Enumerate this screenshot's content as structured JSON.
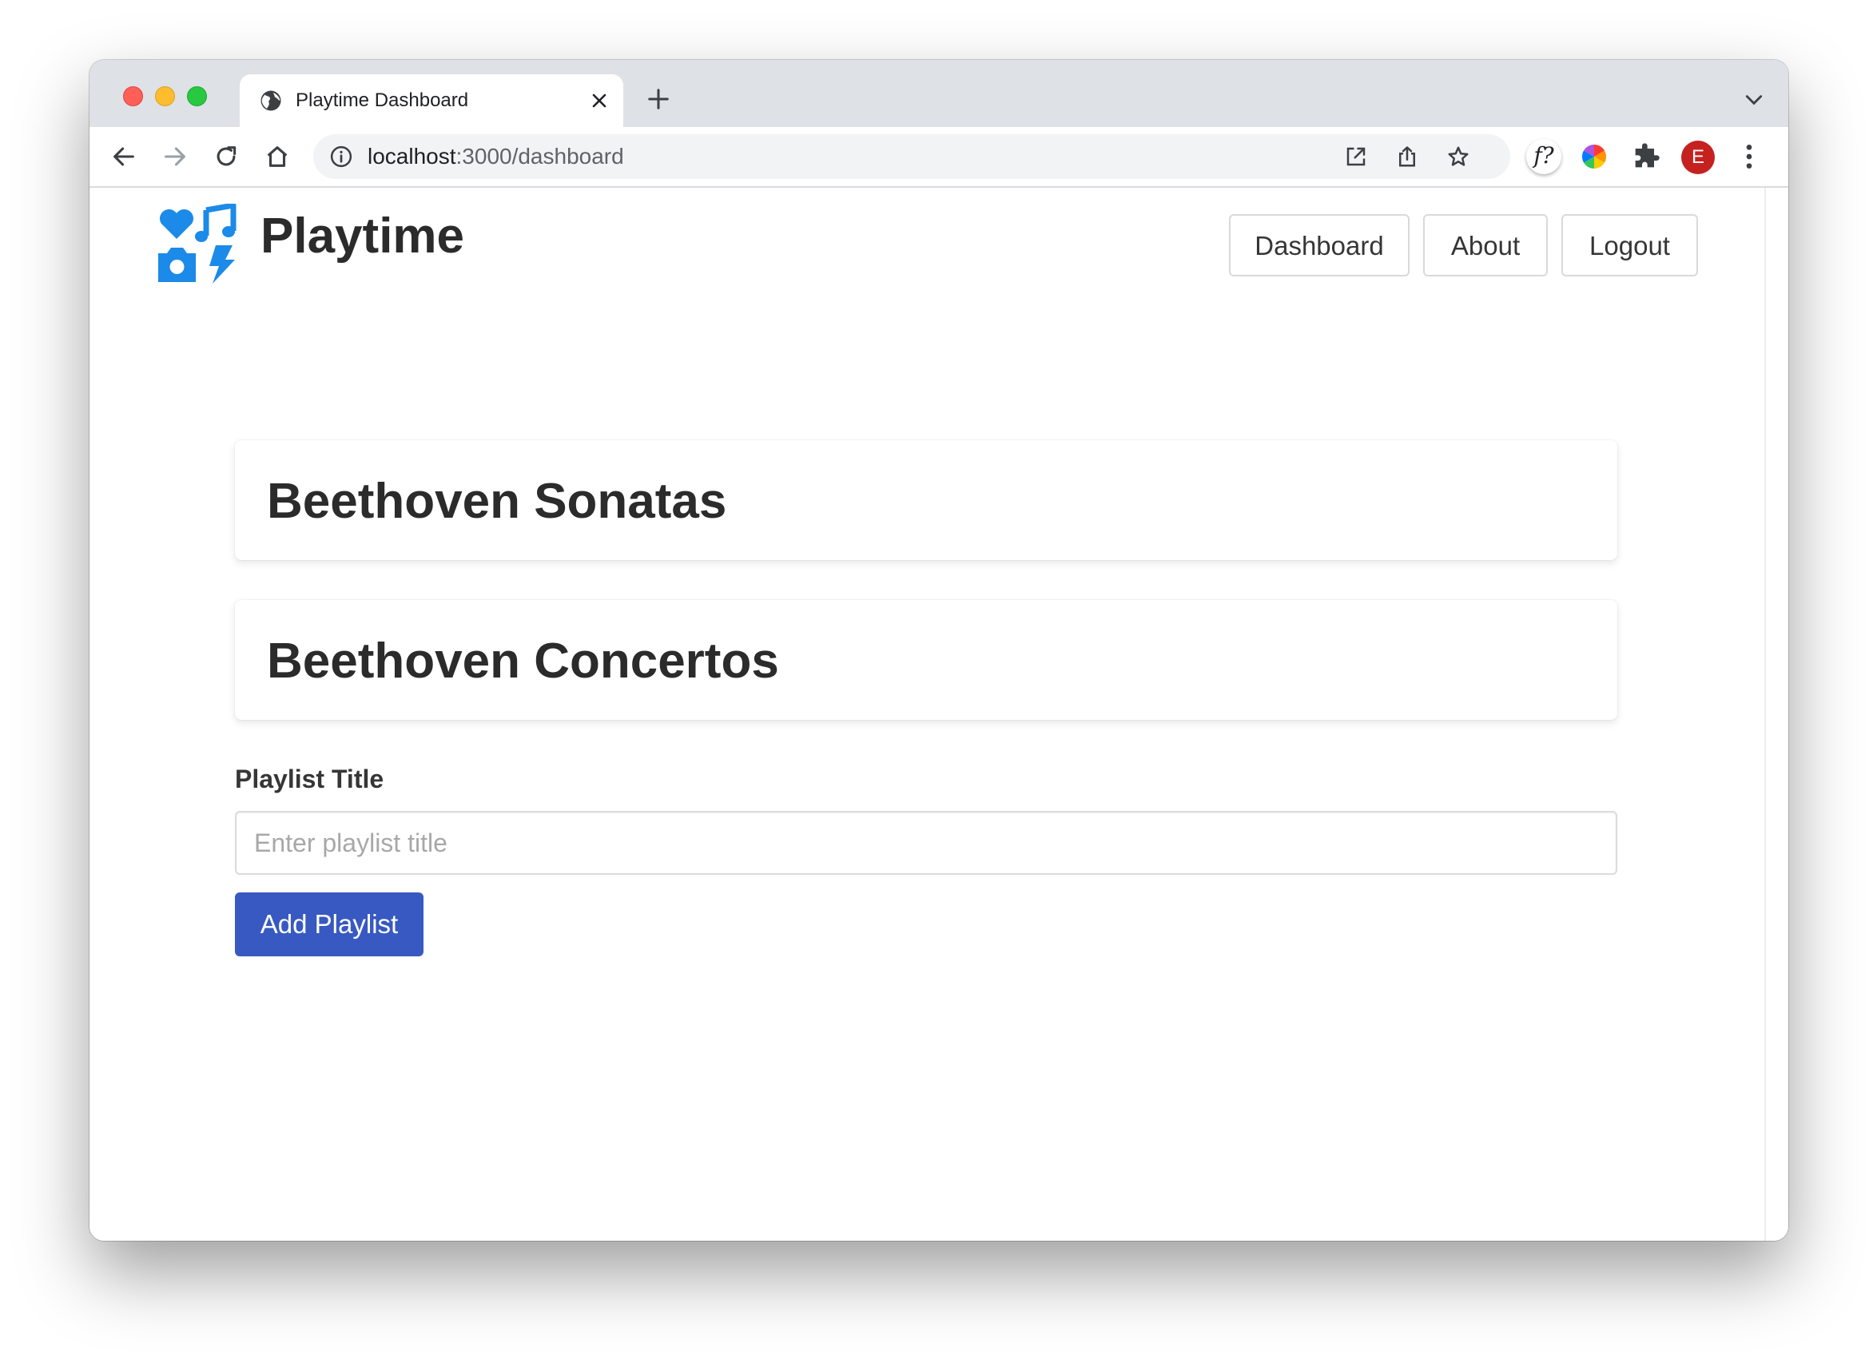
{
  "browser": {
    "tab_title": "Playtime Dashboard",
    "url_host": "localhost",
    "url_path": ":3000/dashboard",
    "profile_initial": "E",
    "fx_extension_label": "f?"
  },
  "header": {
    "brand": "Playtime",
    "nav": [
      {
        "label": "Dashboard"
      },
      {
        "label": "About"
      },
      {
        "label": "Logout"
      }
    ]
  },
  "playlists": [
    {
      "title": "Beethoven Sonatas"
    },
    {
      "title": "Beethoven Concertos"
    }
  ],
  "form": {
    "label": "Playlist Title",
    "placeholder": "Enter playlist title",
    "value": "",
    "submit_label": "Add Playlist"
  },
  "colors": {
    "accent_button": "#3759c1",
    "logo_blue": "#1b8ae8",
    "avatar": "#c5221f"
  },
  "icons": {
    "logo": "heart-music-camera-bolt-icon",
    "back": "arrow-left-icon",
    "forward": "arrow-right-icon",
    "reload": "reload-icon",
    "home": "home-icon",
    "info": "info-icon",
    "open_external": "open-external-icon",
    "share": "share-icon",
    "bookmark": "star-icon",
    "color_picker": "color-wheel-icon",
    "extensions": "puzzle-icon",
    "menu": "kebab-menu-icon"
  }
}
